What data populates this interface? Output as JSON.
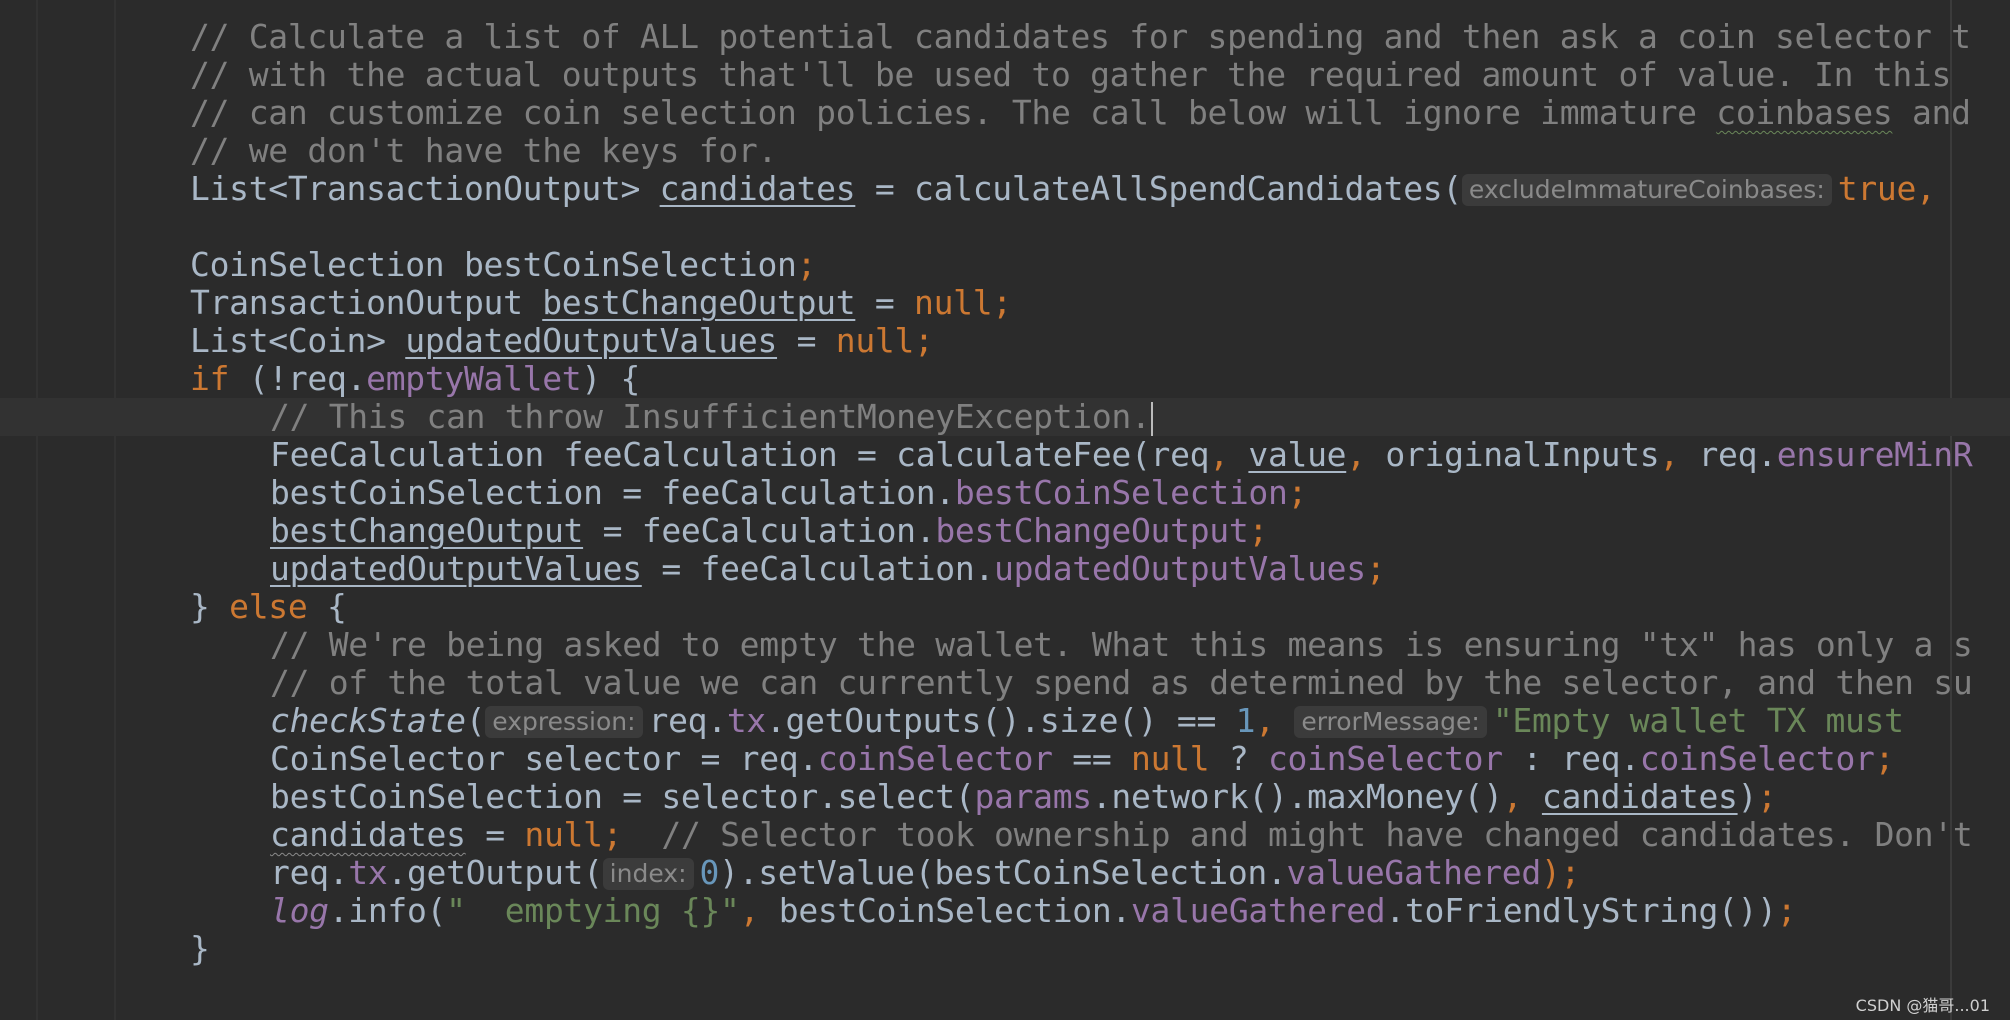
{
  "colors": {
    "background": "#2b2b2b",
    "default_text": "#a9b7c6",
    "comment": "#808080",
    "keyword": "#cc7832",
    "field": "#9876aa",
    "number": "#6897bb",
    "string": "#6a8759",
    "hint_background": "#3b3b3b",
    "current_line": "#323232"
  },
  "lines": [
    {
      "indent": 0,
      "tokens": [
        {
          "t": "// Calculate a list of ALL potential candidates for spending and then ask a coin selector t",
          "c": "comment"
        }
      ]
    },
    {
      "indent": 0,
      "tokens": [
        {
          "t": "// with the actual outputs that'll be used to gather the required amount of value. In this",
          "c": "comment"
        }
      ]
    },
    {
      "indent": 0,
      "tokens": [
        {
          "t": "// can customize coin selection policies. The call below will ignore immature ",
          "c": "comment"
        },
        {
          "t": "coinbases",
          "c": "comment typo"
        },
        {
          "t": " and",
          "c": "comment"
        }
      ]
    },
    {
      "indent": 0,
      "tokens": [
        {
          "t": "// we don't have the keys for.",
          "c": "comment"
        }
      ]
    },
    {
      "indent": 0,
      "tokens": [
        {
          "t": "List<TransactionOutput> "
        },
        {
          "t": "candidates",
          "c": "underline"
        },
        {
          "t": " = calculateAllSpendCandidates("
        },
        {
          "t": "excludeImmatureCoinbases:",
          "c": "hint"
        },
        {
          "t": "true,",
          "c": "keyword"
        }
      ]
    },
    {
      "indent": 0,
      "tokens": []
    },
    {
      "indent": 0,
      "tokens": [
        {
          "t": "CoinSelection bestCoinSelection"
        },
        {
          "t": ";",
          "c": "keyword"
        }
      ]
    },
    {
      "indent": 0,
      "tokens": [
        {
          "t": "TransactionOutput "
        },
        {
          "t": "bestChangeOutput",
          "c": "underline"
        },
        {
          "t": " = "
        },
        {
          "t": "null;",
          "c": "keyword"
        }
      ]
    },
    {
      "indent": 0,
      "tokens": [
        {
          "t": "List<Coin> "
        },
        {
          "t": "updatedOutputValues",
          "c": "underline"
        },
        {
          "t": " = "
        },
        {
          "t": "null;",
          "c": "keyword"
        }
      ]
    },
    {
      "indent": 0,
      "tokens": [
        {
          "t": "if",
          "c": "keyword"
        },
        {
          "t": " (!req."
        },
        {
          "t": "emptyWallet",
          "c": "field"
        },
        {
          "t": ") {"
        }
      ]
    },
    {
      "indent": 1,
      "current": true,
      "caret": true,
      "tokens": [
        {
          "t": "// This can throw InsufficientMoneyException.",
          "c": "comment"
        }
      ]
    },
    {
      "indent": 1,
      "tokens": [
        {
          "t": "FeeCalculation feeCalculation = calculateFee(req"
        },
        {
          "t": ", ",
          "c": "keyword"
        },
        {
          "t": "value",
          "c": "underline"
        },
        {
          "t": ", ",
          "c": "keyword"
        },
        {
          "t": "originalInputs"
        },
        {
          "t": ", ",
          "c": "keyword"
        },
        {
          "t": "req."
        },
        {
          "t": "ensureMinR",
          "c": "field"
        }
      ]
    },
    {
      "indent": 1,
      "tokens": [
        {
          "t": "bestCoinSelection = feeCalculation."
        },
        {
          "t": "bestCoinSelection",
          "c": "field"
        },
        {
          "t": ";",
          "c": "keyword"
        }
      ]
    },
    {
      "indent": 1,
      "tokens": [
        {
          "t": "bestChangeOutput",
          "c": "underline"
        },
        {
          "t": " = feeCalculation."
        },
        {
          "t": "bestChangeOutput",
          "c": "field"
        },
        {
          "t": ";",
          "c": "keyword"
        }
      ]
    },
    {
      "indent": 1,
      "tokens": [
        {
          "t": "updatedOutputValues",
          "c": "underline"
        },
        {
          "t": " = feeCalculation."
        },
        {
          "t": "updatedOutputValues",
          "c": "field"
        },
        {
          "t": ";",
          "c": "keyword"
        }
      ]
    },
    {
      "indent": 0,
      "tokens": [
        {
          "t": "} "
        },
        {
          "t": "else",
          "c": "keyword"
        },
        {
          "t": " {"
        }
      ]
    },
    {
      "indent": 1,
      "tokens": [
        {
          "t": "// We're being asked to empty the wallet. What this means is ensuring \"tx\" has only a s",
          "c": "comment"
        }
      ]
    },
    {
      "indent": 1,
      "tokens": [
        {
          "t": "// of the total value we can currently spend as determined by the selector, and then su",
          "c": "comment"
        }
      ]
    },
    {
      "indent": 1,
      "tokens": [
        {
          "t": "checkState",
          "c": "italic"
        },
        {
          "t": "("
        },
        {
          "t": "expression:",
          "c": "hint"
        },
        {
          "t": "req."
        },
        {
          "t": "tx",
          "c": "field"
        },
        {
          "t": ".getOutputs().size() == "
        },
        {
          "t": "1",
          "c": "number"
        },
        {
          "t": ", ",
          "c": "keyword"
        },
        {
          "t": "errorMessage:",
          "c": "hint"
        },
        {
          "t": "\"Empty wallet TX must",
          "c": "string"
        }
      ]
    },
    {
      "indent": 1,
      "tokens": [
        {
          "t": "CoinSelector selector = req."
        },
        {
          "t": "coinSelector",
          "c": "field"
        },
        {
          "t": " == "
        },
        {
          "t": "null",
          "c": "keyword"
        },
        {
          "t": " ? "
        },
        {
          "t": "coinSelector",
          "c": "field"
        },
        {
          "t": " : req."
        },
        {
          "t": "coinSelector",
          "c": "field"
        },
        {
          "t": ";",
          "c": "keyword"
        }
      ]
    },
    {
      "indent": 1,
      "tokens": [
        {
          "t": "bestCoinSelection = selector.select("
        },
        {
          "t": "params",
          "c": "field"
        },
        {
          "t": ".network().maxMoney()"
        },
        {
          "t": ", ",
          "c": "keyword"
        },
        {
          "t": "candidates",
          "c": "underline"
        },
        {
          "t": ")"
        },
        {
          "t": ";",
          "c": "keyword"
        }
      ]
    },
    {
      "indent": 1,
      "tokens": [
        {
          "t": "candidates",
          "c": "typo-grey"
        },
        {
          "t": " = "
        },
        {
          "t": "null;",
          "c": "keyword"
        },
        {
          "t": "  "
        },
        {
          "t": "// Selector took ownership and might have changed candidates. Don't",
          "c": "comment"
        }
      ]
    },
    {
      "indent": 1,
      "tokens": [
        {
          "t": "req."
        },
        {
          "t": "tx",
          "c": "field"
        },
        {
          "t": ".getOutput("
        },
        {
          "t": "index:",
          "c": "hint"
        },
        {
          "t": "0",
          "c": "number"
        },
        {
          "t": ").setValue(bestCoinSelection."
        },
        {
          "t": "valueGathered",
          "c": "field"
        },
        {
          "t": ");",
          "c": "keyword"
        }
      ]
    },
    {
      "indent": 1,
      "tokens": [
        {
          "t": "log",
          "c": "field italic"
        },
        {
          "t": ".info("
        },
        {
          "t": "\"  emptying {}\"",
          "c": "string"
        },
        {
          "t": ", ",
          "c": "keyword"
        },
        {
          "t": "bestCoinSelection."
        },
        {
          "t": "valueGathered",
          "c": "field"
        },
        {
          "t": ".toFriendlyString())"
        },
        {
          "t": ";",
          "c": "keyword"
        }
      ]
    },
    {
      "indent": 0,
      "tokens": [
        {
          "t": "}"
        }
      ]
    }
  ],
  "watermark": "CSDN @猫哥...01"
}
